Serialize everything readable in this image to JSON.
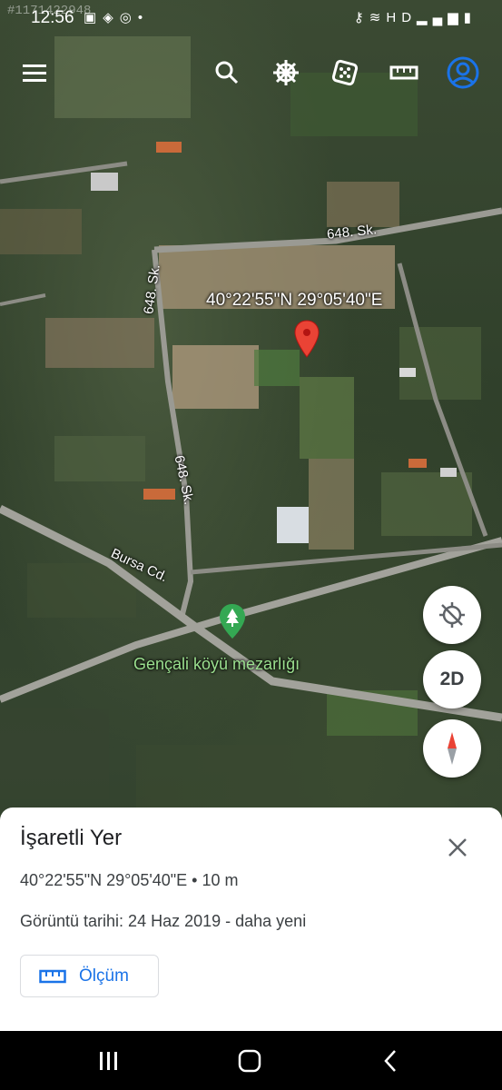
{
  "watermark": "#1171422948",
  "statusbar": {
    "time": "12:56",
    "left_icons": [
      "image-icon",
      "cube-icon",
      "instagram-icon",
      "dot-icon"
    ],
    "right_icons": [
      "key-icon",
      "wifi-icon",
      "hd-icon",
      "signal-icon",
      "battery-icon"
    ]
  },
  "topbar": {
    "icons": [
      "menu-icon",
      "search-icon",
      "voyager-icon",
      "dice-icon",
      "ruler-icon",
      "account-icon"
    ],
    "accent": "#1a73e8"
  },
  "map": {
    "roads": {
      "top": "648. Sk.",
      "left_upper": "648. Sk.",
      "left_lower": "648. Sk.",
      "bursa": "Bursa Cd."
    },
    "pin_coordinates": "40°22'55\"N 29°05'40\"E",
    "poi_name": "Gençali köyü mezarlığı",
    "pin_color": "#ea4335",
    "poi_color": "#34a853"
  },
  "fabs": {
    "view_mode": "2D"
  },
  "sheet": {
    "title": "İşaretli Yer",
    "coords": "40°22'55\"N 29°05'40\"E • 10 m",
    "image_date": "Görüntü tarihi: 24 Haz 2019 - daha yeni",
    "measure_label": "Ölçüm"
  }
}
